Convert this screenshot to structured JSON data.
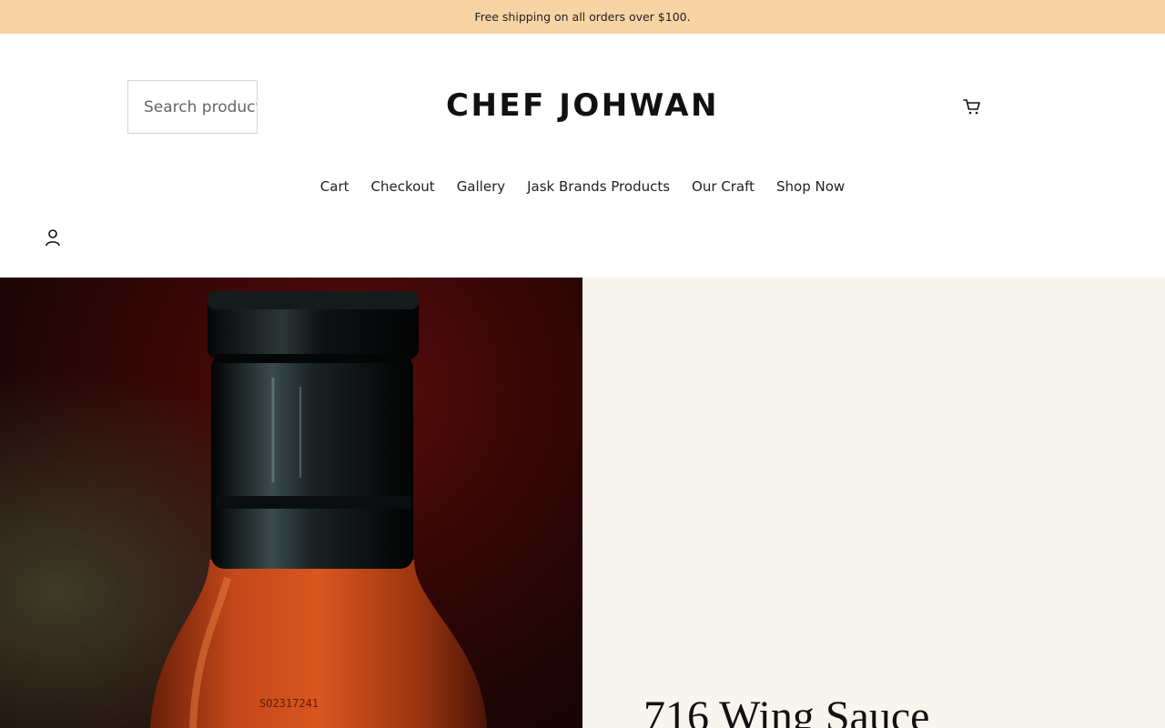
{
  "announcement": {
    "text": "Free shipping on all orders over $100."
  },
  "header": {
    "search_placeholder": "Search products",
    "logo": "CHEF JOHWAN",
    "cart_icon": "cart-icon",
    "account_icon": "account-icon"
  },
  "nav": {
    "items": [
      {
        "label": "Cart"
      },
      {
        "label": "Checkout"
      },
      {
        "label": "Gallery"
      },
      {
        "label": "Jask Brands Products"
      },
      {
        "label": "Our Craft"
      },
      {
        "label": "Shop Now"
      }
    ]
  },
  "product": {
    "image_label": "716 Wing Sauce bottle photo",
    "bottle_code": "SO2317241",
    "title": "716 Wing Sauce"
  },
  "colors": {
    "announcement_bg": "#f8d4a4",
    "panel_bg": "#f8f5ef",
    "text": "#111111"
  }
}
